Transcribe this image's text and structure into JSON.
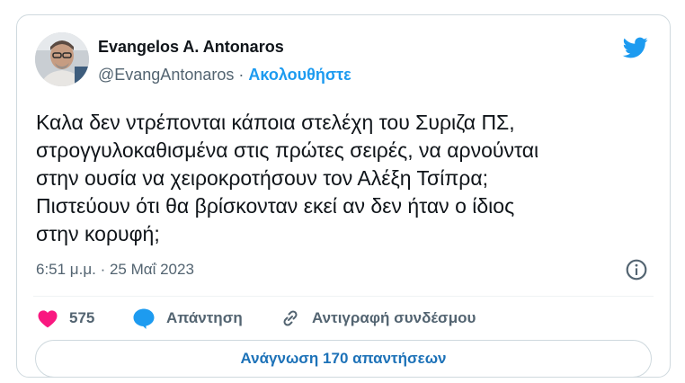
{
  "author": {
    "name": "Evangelos A. Antonaros",
    "handle": "@EvangAntonaros",
    "separator": "·",
    "follow_label": "Ακολουθήστε"
  },
  "tweet": {
    "text": "Καλα δεν ντρέπονται κάποια στελέχη του Συριζα ΠΣ,\nστρογγυλοκαθισμένα στις πρώτες σειρές, να αρνούνται\nστην ουσία να χειροκροτήσουν τον Αλέξη Τσίπρα;\nΠιστεύουν ότι θα βρίσκονταν εκεί αν δεν ήταν ο ίδιος\nστην κορυφή;",
    "timestamp": "6:51 μ.μ. · 25 Μαΐ 2023"
  },
  "actions": {
    "like_count": "575",
    "reply_label": "Απάντηση",
    "copy_link_label": "Αντιγραφή συνδέσμου"
  },
  "read_replies_label": "Ανάγνωση 170 απαντήσεων",
  "colors": {
    "accent": "#1d9bf0",
    "heart": "#f91880",
    "text": "#0f1419",
    "muted": "#536471",
    "border": "#cfd9de"
  },
  "icons": [
    "avatar",
    "twitter-bird-icon",
    "info-icon",
    "heart-icon",
    "reply-bubble-icon",
    "link-icon"
  ]
}
